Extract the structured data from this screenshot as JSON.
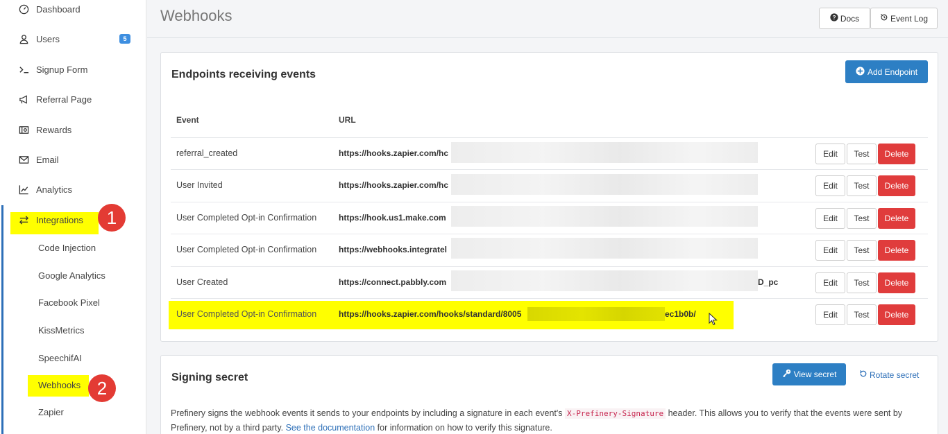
{
  "sidebar": {
    "items": [
      {
        "label": "Dashboard",
        "icon": "dashboard-icon"
      },
      {
        "label": "Users",
        "icon": "user-icon",
        "badge": "5"
      },
      {
        "label": "Signup Form",
        "icon": "terminal-icon"
      },
      {
        "label": "Referral Page",
        "icon": "megaphone-icon"
      },
      {
        "label": "Rewards",
        "icon": "rewards-icon"
      },
      {
        "label": "Email",
        "icon": "envelope-icon"
      },
      {
        "label": "Analytics",
        "icon": "chart-icon"
      },
      {
        "label": "Integrations",
        "icon": "exchange-icon"
      }
    ],
    "sub_items": [
      "Code Injection",
      "Google Analytics",
      "Facebook Pixel",
      "KissMetrics",
      "SpeechifAI",
      "Webhooks",
      "Zapier"
    ]
  },
  "markers": [
    "1",
    "2"
  ],
  "header": {
    "title": "Webhooks",
    "docs_label": "Docs",
    "event_log_label": "Event Log"
  },
  "endpoints": {
    "title": "Endpoints receiving events",
    "add_label": "Add Endpoint",
    "columns": [
      "Event",
      "URL"
    ],
    "rows": [
      {
        "event": "referral_created",
        "url": "https://hooks.zapier.com/hc",
        "url_tail": ""
      },
      {
        "event": "User Invited",
        "url": "https://hooks.zapier.com/hc",
        "url_tail": ""
      },
      {
        "event": "User Completed Opt-in Confirmation",
        "url": "https://hook.us1.make.com",
        "url_tail": ""
      },
      {
        "event": "User Completed Opt-in Confirmation",
        "url": "https://webhooks.integratel",
        "url_tail": ""
      },
      {
        "event": "User Created",
        "url": "https://connect.pabbly.com",
        "url_tail": "D_pc"
      },
      {
        "event": "User Completed Opt-in Confirmation",
        "url": "https://hooks.zapier.com/hooks/standard/8005",
        "url_tail": "ec1b0b/"
      }
    ],
    "edit_label": "Edit",
    "test_label": "Test",
    "delete_label": "Delete"
  },
  "signing": {
    "title": "Signing secret",
    "view_label": "View secret",
    "rotate_label": "Rotate secret",
    "desc_1": "Prefinery signs the webhook events it sends to your endpoints by including a signature in each event's",
    "header_name": "X-Prefinery-Signature",
    "desc_2": "header. This allows you to verify that the events were sent by Prefinery, not by a third party.",
    "doc_link": "See the documentation",
    "desc_3": "for information on how to verify this signature."
  },
  "colors": {
    "highlight": "#ffff00",
    "primary": "#2d7fc4",
    "danger": "#e03c3c",
    "marker": "#e33b34"
  }
}
